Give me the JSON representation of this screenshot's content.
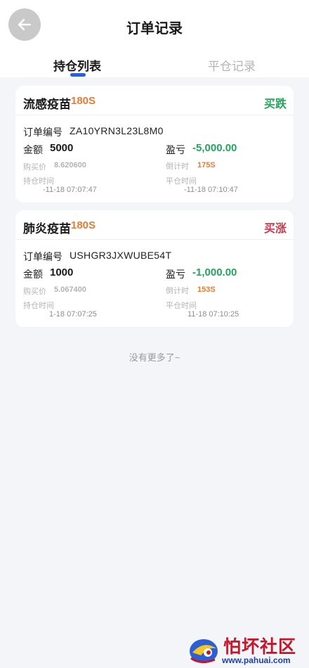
{
  "header": {
    "title": "订单记录",
    "back_icon": "arrow-left-icon"
  },
  "tabs": [
    {
      "label": "持仓列表",
      "active": true
    },
    {
      "label": "平仓记录",
      "active": false
    }
  ],
  "orders": [
    {
      "name": "流感疫苗",
      "duration": "180S",
      "direction": "买跌",
      "order_label": "订单编号",
      "order_no": "ZA10YRN3L23L8M0",
      "amount_label": "金额",
      "amount": "5000",
      "pnl_label": "盈亏",
      "pnl": "-5,000.00",
      "buy_price_label": "购买价",
      "buy_price": "8.620600",
      "countdown_label": "倒计时",
      "countdown": "175S",
      "open_time_label": "持仓时间",
      "open_time": "-11-18 07:07:47",
      "close_time_label": "平仓时间",
      "close_time": "-11-18 07:10:47"
    },
    {
      "name": "肺炎疫苗",
      "duration": "180S",
      "direction": "买涨",
      "order_label": "订单编号",
      "order_no": "USHGR3JXWUBE54T",
      "amount_label": "金额",
      "amount": "1000",
      "pnl_label": "盈亏",
      "pnl": "-1,000.00",
      "buy_price_label": "购买价",
      "buy_price": "5.067400",
      "countdown_label": "倒计时",
      "countdown": "153S",
      "open_time_label": "持仓时间",
      "open_time": "1-18 07:07:25",
      "close_time_label": "平仓时间",
      "close_time": "11-18 07:10:25"
    }
  ],
  "footer": {
    "no_more": "没有更多了~"
  },
  "watermark": {
    "text": "怕坏社区",
    "url": "www.pahuai.com"
  },
  "colors": {
    "accent_blue": "#2f5bd8",
    "down_green": "#23a55d",
    "up_red": "#d0374a",
    "orange": "#e57b36"
  }
}
